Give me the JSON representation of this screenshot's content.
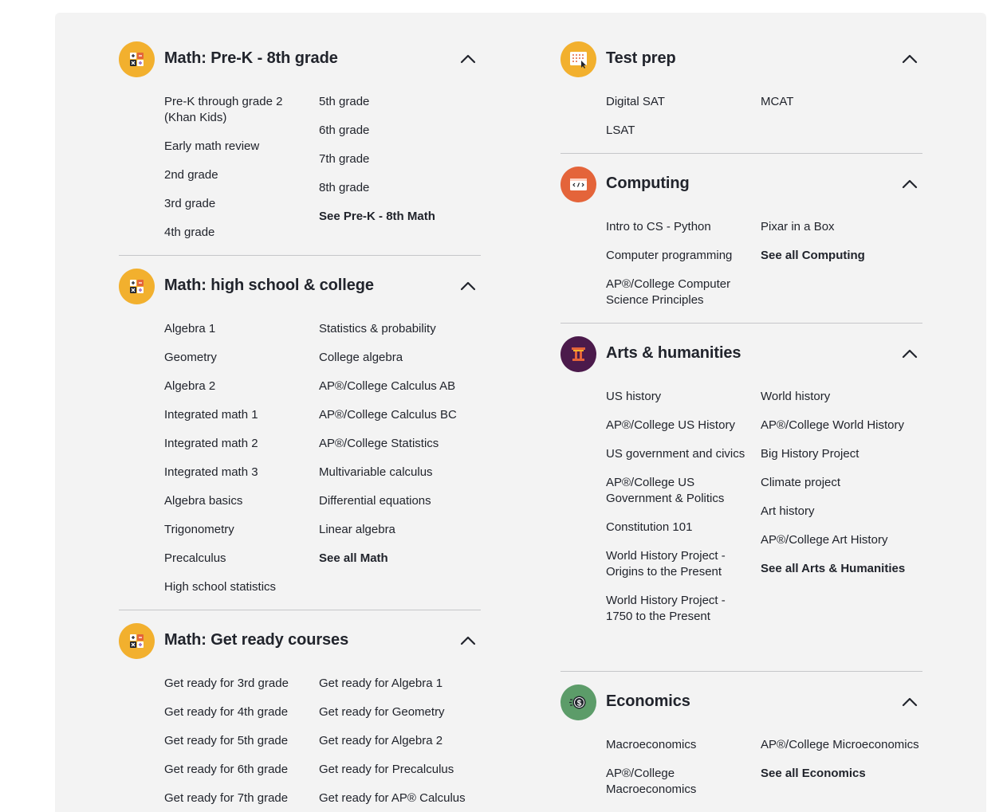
{
  "sections": {
    "math_prek": {
      "title": "Math: Pre-K - 8th grade",
      "icon": "math-calculator-icon",
      "color": "#f2b02e",
      "left": [
        "Pre-K through grade 2 (Khan Kids)",
        "Early math review",
        "2nd grade",
        "3rd grade",
        "4th grade"
      ],
      "right": [
        "5th grade",
        "6th grade",
        "7th grade",
        "8th grade"
      ],
      "see_all": "See Pre-K - 8th Math"
    },
    "math_hs": {
      "title": "Math: high school & college",
      "icon": "math-calculator-icon",
      "color": "#f2b02e",
      "left": [
        "Algebra 1",
        "Geometry",
        "Algebra 2",
        "Integrated math 1",
        "Integrated math 2",
        "Integrated math 3",
        "Algebra basics",
        "Trigonometry",
        "Precalculus",
        "High school statistics"
      ],
      "right": [
        "Statistics & probability",
        "College algebra",
        "AP®/College Calculus AB",
        "AP®/College Calculus BC",
        "AP®/College Statistics",
        "Multivariable calculus",
        "Differential equations",
        "Linear algebra"
      ],
      "see_all": "See all Math"
    },
    "math_ready": {
      "title": "Math: Get ready courses",
      "icon": "math-calculator-icon",
      "color": "#f2b02e",
      "left": [
        "Get ready for 3rd grade",
        "Get ready for 4th grade",
        "Get ready for 5th grade",
        "Get ready for 6th grade",
        "Get ready for 7th grade"
      ],
      "right": [
        "Get ready for Algebra 1",
        "Get ready for Geometry",
        "Get ready for Algebra 2",
        "Get ready for Precalculus",
        "Get ready for AP® Calculus"
      ]
    },
    "test_prep": {
      "title": "Test prep",
      "icon": "test-prep-icon",
      "color": "#f2b02e",
      "left": [
        "Digital SAT",
        "LSAT"
      ],
      "right": [
        "MCAT"
      ]
    },
    "computing": {
      "title": "Computing",
      "icon": "code-window-icon",
      "color": "#e4643a",
      "left": [
        "Intro to CS - Python",
        "Computer programming",
        "AP®/College Computer Science Principles"
      ],
      "right": [
        "Pixar in a Box"
      ],
      "see_all": "See all Computing"
    },
    "arts": {
      "title": "Arts & humanities",
      "icon": "column-icon",
      "color": "#4b1a4b",
      "left": [
        "US history",
        "AP®/College US History",
        "US government and civics",
        "AP®/College US Government & Politics",
        "Constitution 101",
        "World History Project - Origins to the Present",
        "World History Project - 1750 to the Present"
      ],
      "right": [
        "World history",
        "AP®/College World History",
        "Big History Project",
        "Climate project",
        "Art history",
        "AP®/College Art History"
      ],
      "see_all": "See all Arts & Humanities"
    },
    "economics": {
      "title": "Economics",
      "icon": "dollar-coin-icon",
      "color": "#5c9c69",
      "left": [
        "Macroeconomics",
        "AP®/College Macroeconomics"
      ],
      "right": [
        "AP®/College Microeconomics"
      ],
      "see_all": "See all Economics"
    }
  }
}
